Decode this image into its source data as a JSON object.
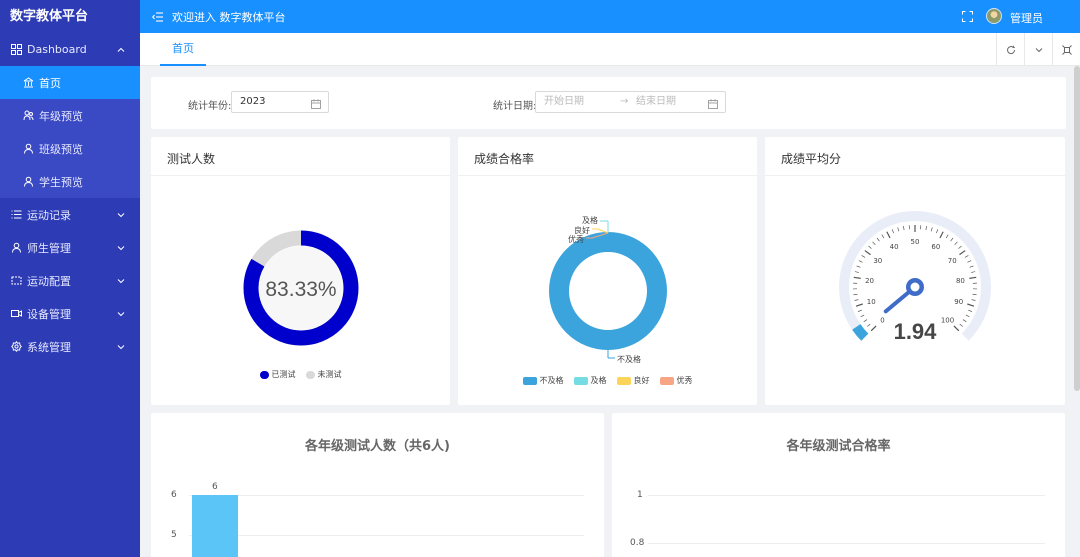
{
  "app": {
    "brand": "数字教体平台"
  },
  "header": {
    "welcome": "欢迎进入 数字教体平台",
    "user": "管理员"
  },
  "tabs": [
    {
      "label": "首页"
    }
  ],
  "sidebar": {
    "dashboard": "Dashboard",
    "sub": [
      "首页",
      "年级预览",
      "班级预览",
      "学生预览"
    ],
    "items": [
      "运动记录",
      "师生管理",
      "运动配置",
      "设备管理",
      "系统管理"
    ]
  },
  "filters": {
    "year_label": "统计年份:",
    "year_value": "2023",
    "date_label": "统计日期:",
    "start_placeholder": "开始日期",
    "arrow": "→",
    "end_placeholder": "结束日期"
  },
  "cards": {
    "test_count": {
      "title": "测试人数",
      "percent_text": "83.33%",
      "legend": [
        "已测试",
        "未测试"
      ],
      "tested_ratio": 0.8333
    },
    "pass_rate": {
      "title": "成绩合格率",
      "legend": [
        "不及格",
        "及格",
        "良好",
        "优秀"
      ],
      "labels": {
        "fail": "不及格",
        "pass": "及格",
        "good": "良好",
        "excellent": "优秀"
      }
    },
    "avg_score": {
      "title": "成绩平均分",
      "value": "1.94",
      "ticks": [
        "0",
        "10",
        "20",
        "30",
        "40",
        "50",
        "60",
        "70",
        "80",
        "90",
        "100"
      ]
    }
  },
  "bottom": {
    "grade_count": {
      "title": "各年级测试人数（共6人)",
      "y_ticks": [
        "6",
        "5"
      ],
      "bar_label": "6"
    },
    "grade_pass": {
      "title": "各年级测试合格率",
      "y_ticks": [
        "1",
        "0.8"
      ]
    }
  },
  "colors": {
    "accent": "#1890ff",
    "sidebar": "#2d3bb5",
    "tested": "#0000cc",
    "untested": "#d9d9d9",
    "fail": "#3ba4dc",
    "pass": "#75dce3",
    "good": "#fcd45a",
    "excellent": "#f7a584",
    "gauge": "#3f6cc8",
    "bar": "#5bc5f8"
  },
  "chart_data": [
    {
      "type": "pie",
      "title": "测试人数",
      "categories": [
        "已测试",
        "未测试"
      ],
      "values": [
        83.33,
        16.67
      ]
    },
    {
      "type": "pie",
      "title": "成绩合格率",
      "categories": [
        "不及格",
        "及格",
        "良好",
        "优秀"
      ],
      "values": [
        100,
        0,
        0,
        0
      ]
    },
    {
      "type": "bar",
      "title": "各年级测试人数（共6人)",
      "categories": [
        ""
      ],
      "values": [
        6
      ],
      "ylim": [
        4,
        6
      ]
    }
  ]
}
